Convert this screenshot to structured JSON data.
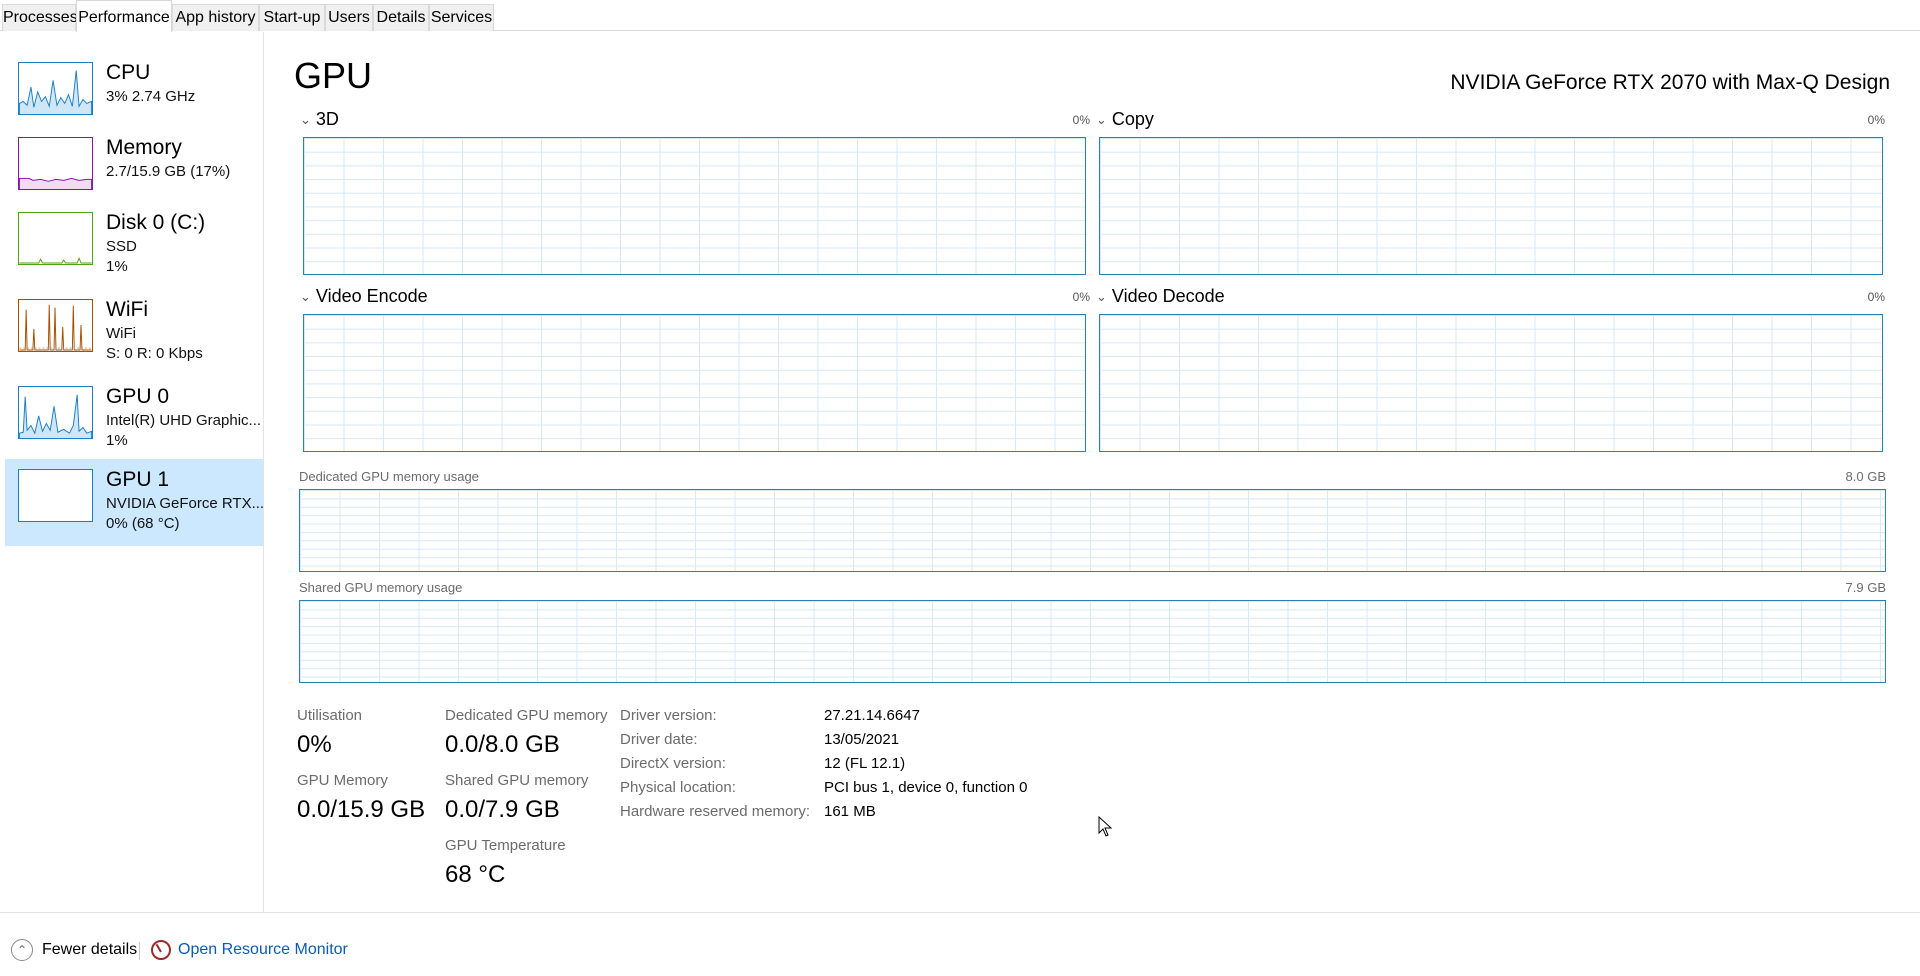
{
  "tabs": [
    {
      "label": "Processes",
      "active": false
    },
    {
      "label": "Performance",
      "active": true
    },
    {
      "label": "App history",
      "active": false
    },
    {
      "label": "Start-up",
      "active": false
    },
    {
      "label": "Users",
      "active": false
    },
    {
      "label": "Details",
      "active": false
    },
    {
      "label": "Services",
      "active": false
    }
  ],
  "sidebar": {
    "items": [
      {
        "title": "CPU",
        "line1": "3%  2.74 GHz",
        "line2": "",
        "color": "#1b7fc4"
      },
      {
        "title": "Memory",
        "line1": "2.7/15.9 GB (17%)",
        "line2": "",
        "color": "#8b12ae"
      },
      {
        "title": "Disk 0 (C:)",
        "line1": "SSD",
        "line2": "1%",
        "color": "#4da60c"
      },
      {
        "title": "WiFi",
        "line1": "WiFi",
        "line2": "S: 0  R: 0 Kbps",
        "color": "#a74f01"
      },
      {
        "title": "GPU 0",
        "line1": "Intel(R) UHD Graphic...",
        "line2": "1%",
        "color": "#1b7fc4"
      },
      {
        "title": "GPU 1",
        "line1": "NVIDIA GeForce RTX...",
        "line2": "0%  (68 °C)",
        "color": "#1b7fc4",
        "selected": true
      }
    ]
  },
  "main": {
    "title": "GPU",
    "device_name": "NVIDIA GeForce RTX 2070 with Max-Q Design",
    "engines": [
      {
        "label": "3D",
        "pct": "0%"
      },
      {
        "label": "Copy",
        "pct": "0%"
      },
      {
        "label": "Video Encode",
        "pct": "0%"
      },
      {
        "label": "Video Decode",
        "pct": "0%"
      }
    ],
    "dedicated_mem_label": "Dedicated GPU memory usage",
    "dedicated_mem_max": "8.0 GB",
    "shared_mem_label": "Shared GPU memory usage",
    "shared_mem_max": "7.9 GB",
    "stats": {
      "utilisation_label": "Utilisation",
      "utilisation": "0%",
      "gpu_memory_label": "GPU Memory",
      "gpu_memory": "0.0/15.9 GB",
      "dedicated_label": "Dedicated GPU memory",
      "dedicated": "0.0/8.0 GB",
      "shared_label": "Shared GPU memory",
      "shared": "0.0/7.9 GB",
      "temp_label": "GPU Temperature",
      "temp": "68 °C"
    },
    "info": [
      {
        "label": "Driver version:",
        "value": "27.21.14.6647"
      },
      {
        "label": "Driver date:",
        "value": "13/05/2021"
      },
      {
        "label": "DirectX version:",
        "value": "12 (FL 12.1)"
      },
      {
        "label": "Physical location:",
        "value": "PCI bus 1, device 0, function 0"
      },
      {
        "label": "Hardware reserved memory:",
        "value": "161 MB"
      }
    ]
  },
  "footer": {
    "fewer_details": "Fewer details",
    "open_resource_monitor": "Open Resource Monitor"
  }
}
